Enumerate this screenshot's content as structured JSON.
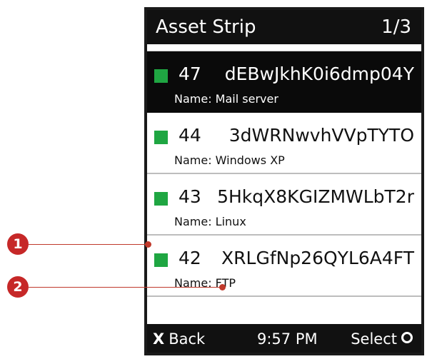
{
  "header": {
    "title": "Asset Strip",
    "page_indicator": "1/3"
  },
  "assets": [
    {
      "number": "47",
      "code": "dEBwJkhK0i6dmp04Y",
      "name": "Name: Mail server",
      "selected": true
    },
    {
      "number": "44",
      "code": "3dWRNwvhVVpTYTO",
      "name": "Name: Windows XP",
      "selected": false
    },
    {
      "number": "43",
      "code": "5HkqX8KGIZMWLbT2r",
      "name": "Name: Linux",
      "selected": false
    },
    {
      "number": "42",
      "code": "XRLGfNp26QYL6A4FT",
      "name": "Name: FTP",
      "selected": false
    }
  ],
  "footer": {
    "back_label": "Back",
    "back_icon": "x-icon",
    "time": "9:57 PM",
    "select_label": "Select",
    "select_icon": "circle-icon"
  },
  "callouts": [
    {
      "label": "1"
    },
    {
      "label": "2"
    }
  ],
  "colors": {
    "status_green": "#1fa642",
    "callout_red": "#c62828",
    "bar_black": "#111111"
  }
}
